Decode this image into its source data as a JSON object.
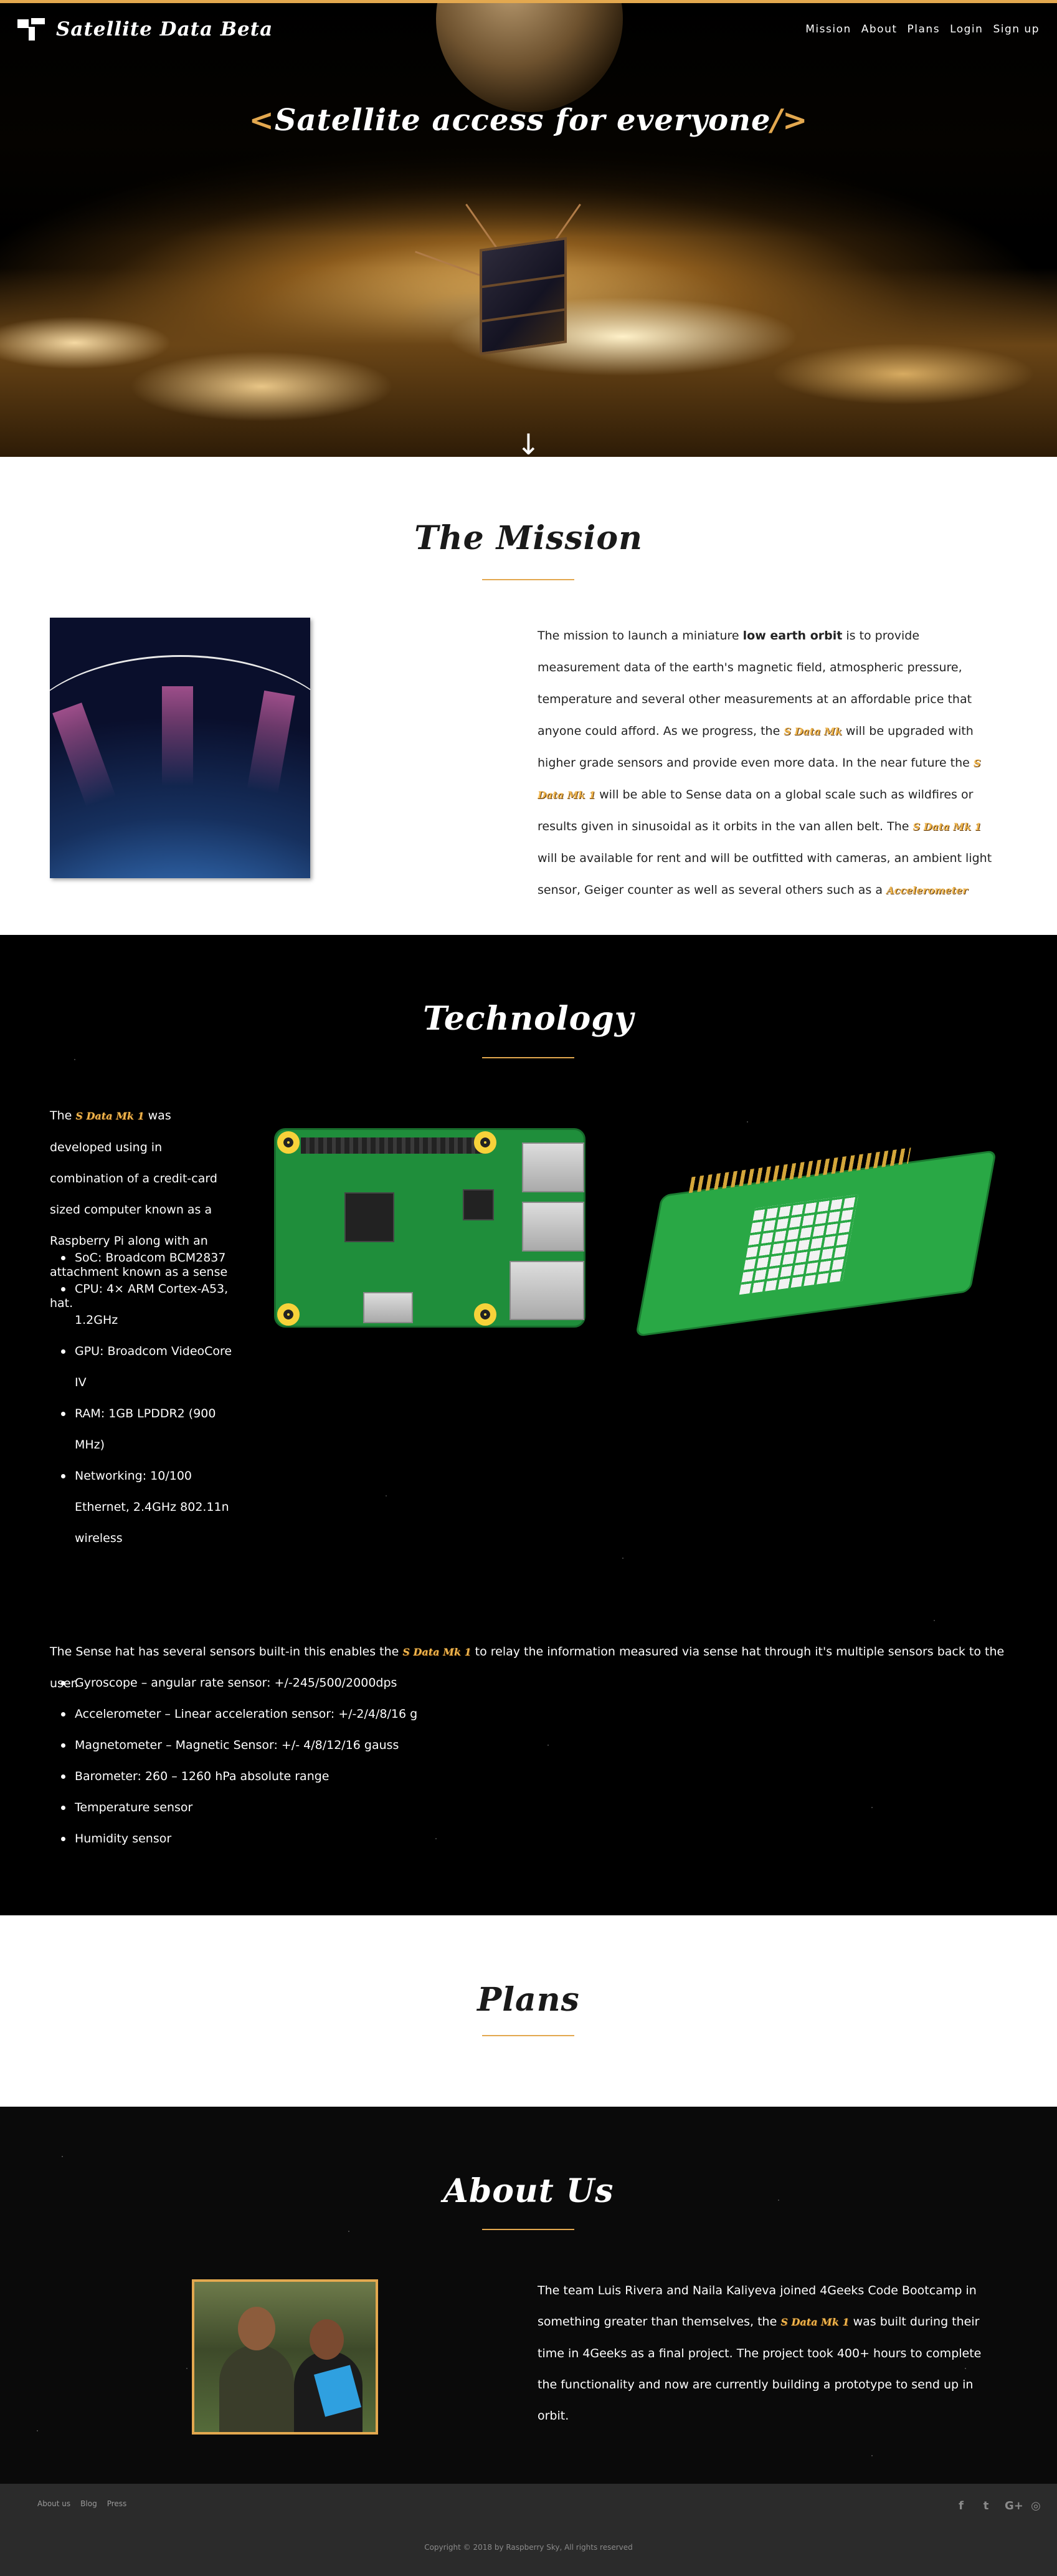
{
  "nav": {
    "brand": "Satellite Data Beta",
    "links": [
      "Mission",
      "About",
      "Plans",
      "Login",
      "Sign up"
    ]
  },
  "hero": {
    "title_open": "<",
    "title": "Satellite access for everyone",
    "title_close": "/>",
    "down_icon": "arrow-down-icon"
  },
  "mission": {
    "title": "The Mission",
    "text_1": "The mission to launch a miniature ",
    "bold": "low earth orbit",
    "text_2": " is to provide measurement data of the earth's magnetic field, atmospheric pressure, temperature and several other measurements at an affordable price that anyone could afford. As we progress, the ",
    "tag_1": "S Data Mk",
    "text_3": " will be upgraded with higher grade sensors and provide even more data. In the near future the ",
    "tag_2": "S Data Mk 1",
    "text_4": " will be able to Sense data on a global scale such as wildfires or results given in sinusoidal as it orbits in the van allen belt. The ",
    "tag_3": "S Data Mk 1",
    "text_5": " will be available for rent and will be outfitted with cameras, an ambient light sensor, Geiger counter as well as several others such as a ",
    "tag_4": "Accelerometer"
  },
  "technology": {
    "title": "Technology",
    "intro_1": "The ",
    "intro_tag": "S Data Mk 1",
    "intro_2": " was developed using in combination of a credit-card sized computer known as a Raspberry Pi along with an attachment known as a sense hat.",
    "specs": [
      "SoC: Broadcom BCM2837",
      "CPU: 4× ARM Cortex-A53, 1.2GHz",
      "GPU: Broadcom VideoCore IV",
      "RAM: 1GB LPDDR2 (900 MHz)",
      "Networking: 10/100 Ethernet, 2.4GHz 802.11n wireless"
    ],
    "sense_1": "The Sense hat has several sensors built-in this enables the ",
    "sense_tag": "S Data Mk 1",
    "sense_2": " to relay the information measured via sense hat through it's multiple sensors back to the user.",
    "sensors": [
      "Gyroscope – angular rate sensor: +/-245/500/2000dps",
      "Accelerometer – Linear acceleration sensor: +/-2/4/8/16 g",
      "Magnetometer – Magnetic Sensor: +/- 4/8/12/16 gauss",
      "Barometer: 260 – 1260 hPa absolute range",
      "Temperature sensor",
      "Humidity sensor"
    ]
  },
  "plans": {
    "title": "Plans"
  },
  "about": {
    "title": "About Us",
    "text_1": "The team Luis Rivera and Naila Kaliyeva joined 4Geeks Code Bootcamp in something greater than themselves, the ",
    "tag": "S Data Mk 1",
    "text_2": " was built during their time in 4Geeks as a final project. The project took 400+ hours to complete the functionality and now are currently building a prototype to send up in orbit."
  },
  "footer": {
    "links": [
      "About us",
      "Blog",
      "Press"
    ],
    "social_icons": [
      "facebook-icon",
      "twitter-icon",
      "google-plus-icon",
      "instagram-icon"
    ],
    "social_glyphs": [
      "f",
      "t",
      "G+",
      "◎"
    ],
    "copyright": "Copyright © 2018 by Raspberry Sky, All rights reserved"
  },
  "colors": {
    "accent": "#e3a84f",
    "tag": "#f0b64d",
    "footer_bg": "#2b2b2b"
  }
}
